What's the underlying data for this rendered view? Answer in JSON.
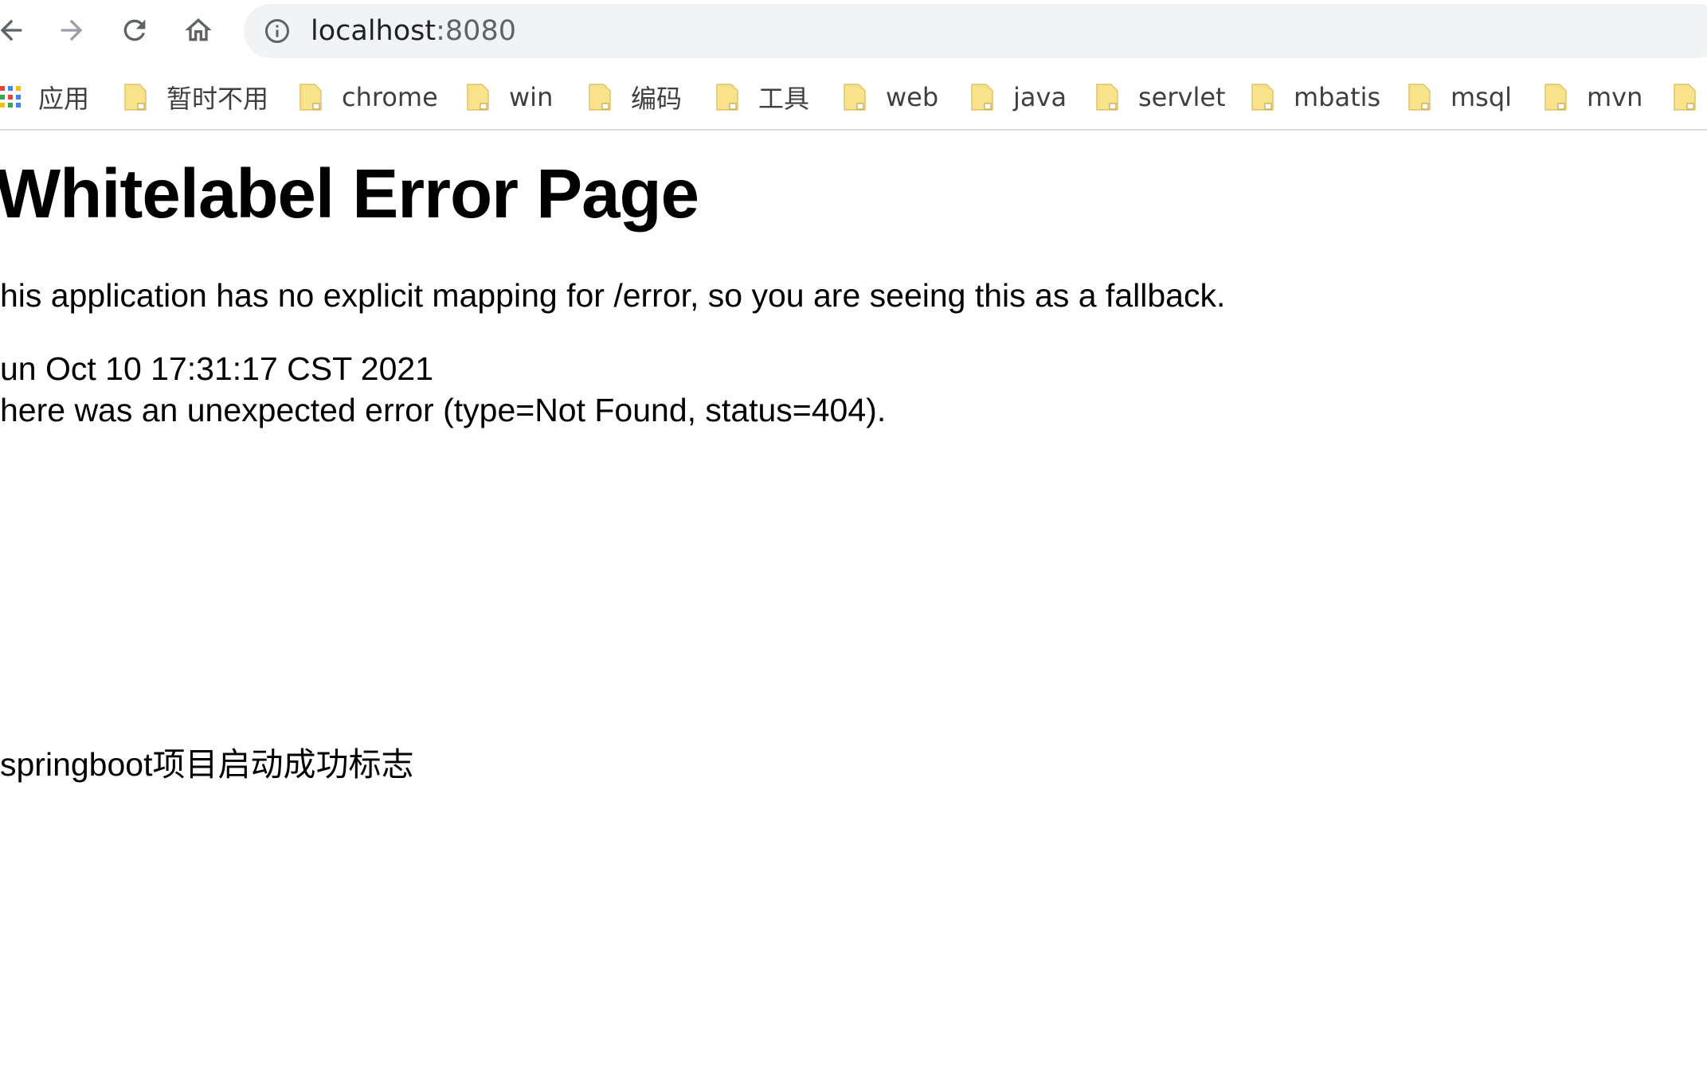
{
  "nav": {
    "back_icon": "arrow-left-icon",
    "forward_icon": "arrow-right-icon",
    "reload_icon": "reload-icon",
    "home_icon": "home-icon"
  },
  "address_bar": {
    "host": "localhost",
    "port": ":8080",
    "security_icon": "info-icon"
  },
  "bookmarks": {
    "apps_label": "应用",
    "items": [
      {
        "label": "暂时不用"
      },
      {
        "label": "chrome"
      },
      {
        "label": "win"
      },
      {
        "label": "编码"
      },
      {
        "label": "工具"
      },
      {
        "label": "web"
      },
      {
        "label": "java"
      },
      {
        "label": "servlet"
      },
      {
        "label": "mbatis"
      },
      {
        "label": "msql"
      },
      {
        "label": "mvn"
      },
      {
        "label": ""
      }
    ]
  },
  "page": {
    "title": "Whitelabel Error Page",
    "message": "his application has no explicit mapping for /error, so you are seeing this as a fallback.",
    "timestamp": "un Oct 10 17:31:17 CST 2021",
    "error_detail": "here was an unexpected error (type=Not Found, status=404).",
    "annotation": "springboot项目启动成功标志"
  },
  "colors": {
    "annotation": "#e31b23",
    "folder": "#f8e38c",
    "omnibox": "#f1f3f4"
  }
}
